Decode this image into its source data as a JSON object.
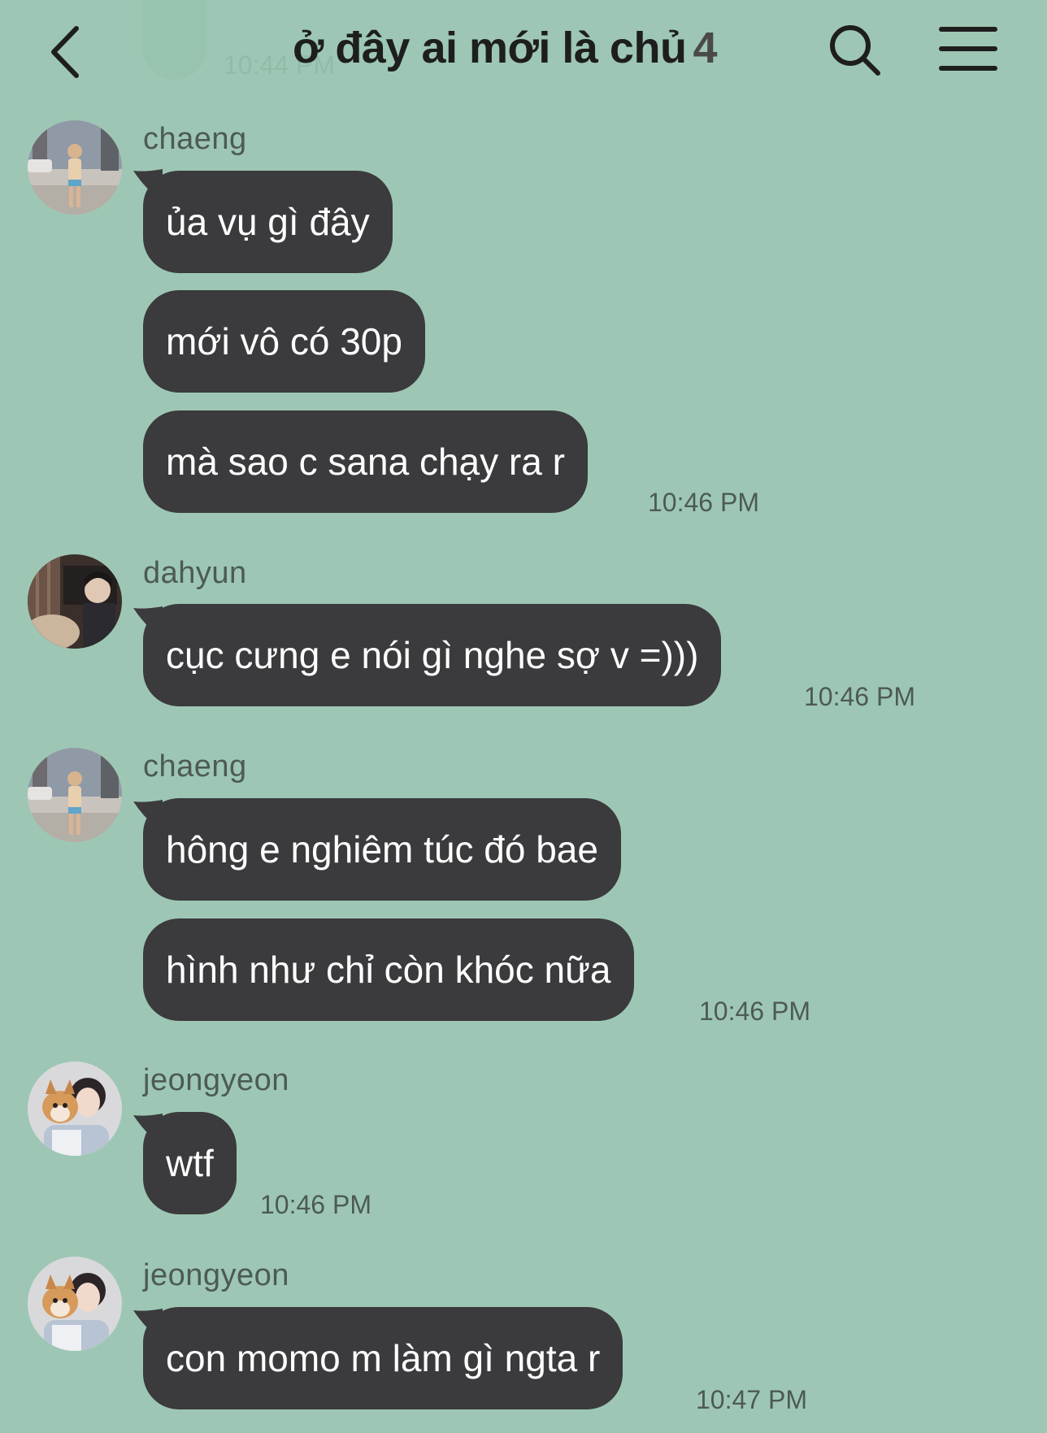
{
  "header": {
    "back_icon": "chevron-left-icon",
    "ghost_time": "10:44 PM",
    "title": "ở đây ai mới là chủ",
    "member_count": "4",
    "search_icon": "search-icon",
    "menu_icon": "menu-icon"
  },
  "colors": {
    "background": "#9dc7b4",
    "bubble": "#3b3a3d",
    "bubble_text": "#ffffff",
    "meta_text": "#4d5a55"
  },
  "messages": [
    {
      "sender": "chaeng",
      "bubbles": [
        "ủa vụ gì đây",
        "mới vô có 30p",
        "mà sao c sana chạy ra r"
      ],
      "time": "10:46 PM"
    },
    {
      "sender": "dahyun",
      "bubbles": [
        "cục cưng e nói gì nghe sợ v =)))"
      ],
      "time": "10:46 PM"
    },
    {
      "sender": "chaeng",
      "bubbles": [
        "hông e nghiêm túc đó bae",
        "hình như chỉ còn khóc nữa"
      ],
      "time": "10:46 PM"
    },
    {
      "sender": "jeongyeon",
      "bubbles": [
        "wtf"
      ],
      "time": "10:46 PM"
    },
    {
      "sender": "jeongyeon",
      "bubbles": [
        "con momo m làm gì ngta r"
      ],
      "time": "10:47 PM"
    }
  ]
}
